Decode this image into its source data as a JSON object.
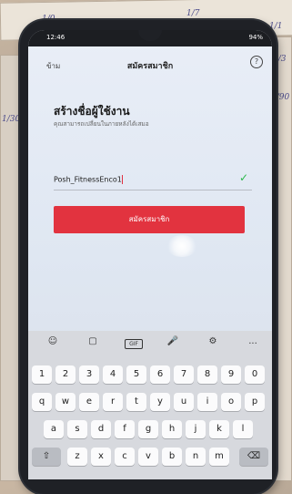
{
  "background_scribbles": [
    "1/0",
    "1/7",
    "1/1",
    "1/3",
    "1/30",
    "1/90"
  ],
  "statusbar": {
    "time": "12:46",
    "right": "94%"
  },
  "appbar": {
    "back_label": "ข้าม",
    "title": "สมัครสมาชิก",
    "help_icon": "?"
  },
  "form": {
    "heading": "สร้างชื่อผู้ใช้งาน",
    "subtext": "คุณสามารถเปลี่ยนในภายหลังได้เสมอ",
    "username_value": "Posh_FitnessEnco1",
    "valid_icon": "✓"
  },
  "signup_button": {
    "label": "สมัครสมาชิก"
  },
  "keyboard": {
    "tools": [
      "☺",
      "▢",
      "GIF",
      "🎤",
      "⚙",
      "..."
    ],
    "row_numbers": [
      "1",
      "2",
      "3",
      "4",
      "5",
      "6",
      "7",
      "8",
      "9",
      "0"
    ],
    "row1": [
      "q",
      "w",
      "e",
      "r",
      "t",
      "y",
      "u",
      "i",
      "o",
      "p"
    ],
    "row2": [
      "a",
      "s",
      "d",
      "f",
      "g",
      "h",
      "j",
      "k",
      "l"
    ],
    "row3": [
      "z",
      "x",
      "c",
      "v",
      "b",
      "n",
      "m"
    ],
    "shift": "⇧",
    "backspace": "⌫"
  }
}
